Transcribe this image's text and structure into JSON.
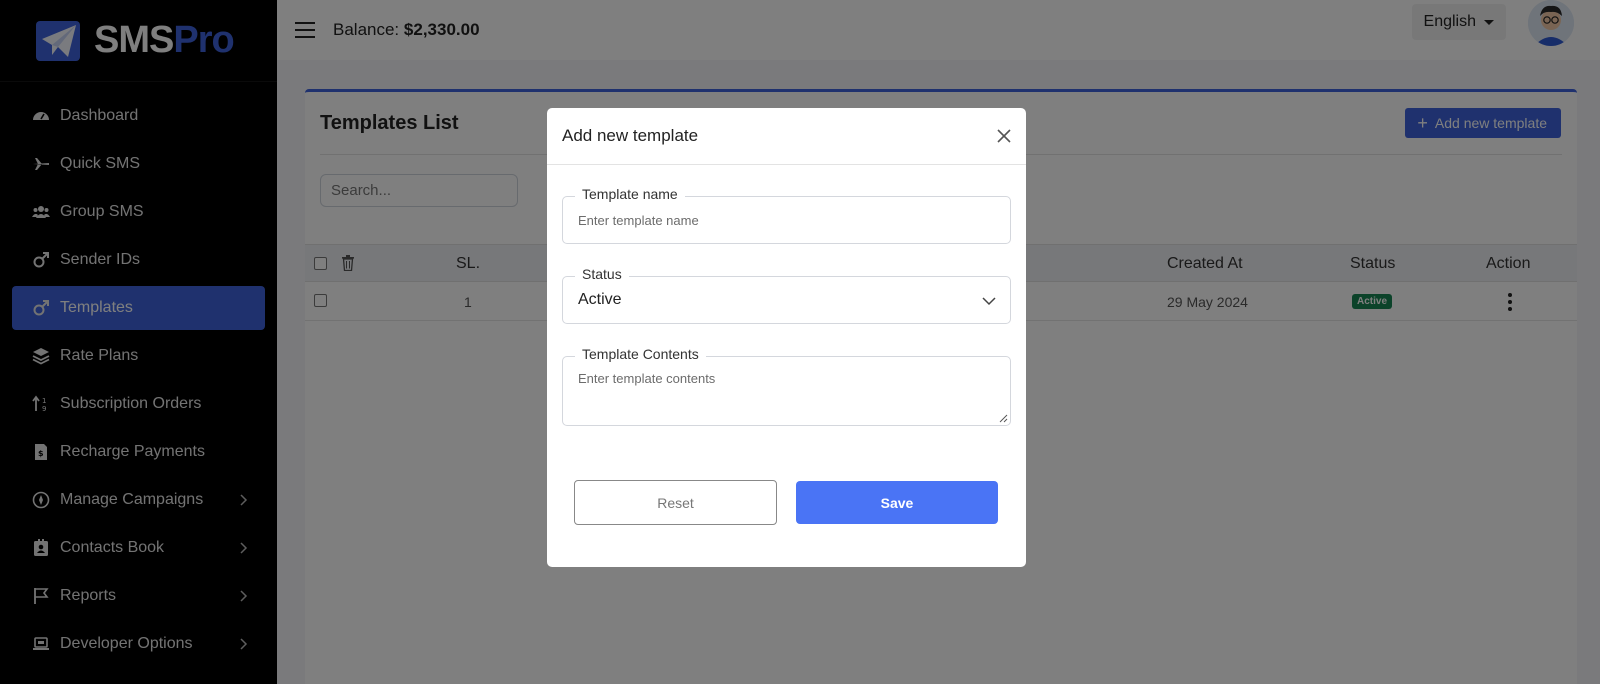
{
  "brand": {
    "name_part1": "SMS",
    "name_part2": "Pro"
  },
  "sidebar": {
    "items": [
      {
        "label": "Dashboard",
        "icon": "gauge-icon"
      },
      {
        "label": "Quick SMS",
        "icon": "plane-icon"
      },
      {
        "label": "Group SMS",
        "icon": "users-icon"
      },
      {
        "label": "Sender IDs",
        "icon": "mars-icon"
      },
      {
        "label": "Templates",
        "icon": "mars-icon",
        "active": true
      },
      {
        "label": "Rate Plans",
        "icon": "layers-icon"
      },
      {
        "label": "Subscription Orders",
        "icon": "sort-icon"
      },
      {
        "label": "Recharge Payments",
        "icon": "invoice-icon"
      },
      {
        "label": "Manage Campaigns",
        "icon": "campaign-icon",
        "submenu": true
      },
      {
        "label": "Contacts Book",
        "icon": "contact-book-icon",
        "submenu": true
      },
      {
        "label": "Reports",
        "icon": "flag-icon",
        "submenu": true
      },
      {
        "label": "Developer Options",
        "icon": "laptop-icon",
        "submenu": true
      }
    ]
  },
  "topbar": {
    "balance_label": "Balance:",
    "balance_value": "$2,330.00",
    "language": "English"
  },
  "page": {
    "title": "Templates List",
    "add_button": "Add new template",
    "search_placeholder": "Search...",
    "columns": {
      "sl": "SL.",
      "created_at": "Created At",
      "status": "Status",
      "action": "Action"
    },
    "rows": [
      {
        "sl": "1",
        "created_at": "29 May 2024",
        "status": "Active"
      }
    ]
  },
  "modal": {
    "title": "Add new template",
    "name_label": "Template name",
    "name_placeholder": "Enter template name",
    "status_label": "Status",
    "status_value": "Active",
    "contents_label": "Template Contents",
    "contents_placeholder": "Enter template contents",
    "reset_label": "Reset",
    "save_label": "Save"
  },
  "colors": {
    "primary": "#3e63dd",
    "save": "#4a74f5",
    "success": "#198754",
    "sidebar_bg": "#000000"
  }
}
